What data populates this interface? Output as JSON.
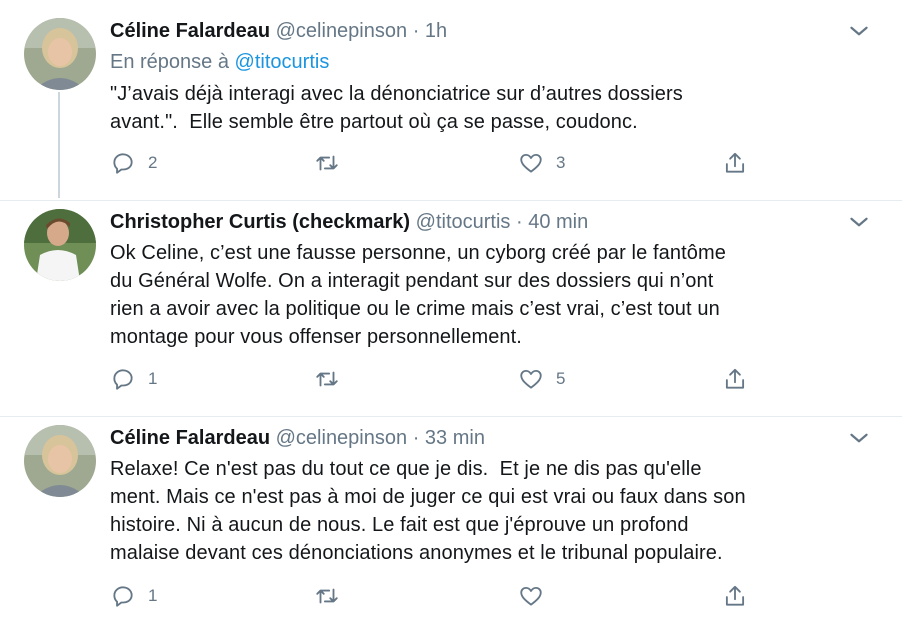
{
  "tweets": [
    {
      "name": "Céline Falardeau",
      "handle": "@celinepinson",
      "separator": "·",
      "time": "1h",
      "reply_prefix": "En réponse à",
      "reply_to": "@titocurtis",
      "text": "\"J’avais déjà interagi avec la dénonciatrice sur d’autres dossiers\navant.\".  Elle semble être partout où ça se passe, coudonc.",
      "replies": "2",
      "retweets": "",
      "likes": "3"
    },
    {
      "name": "Christopher Curtis (checkmark)",
      "handle": "@titocurtis",
      "separator": "·",
      "time": "40 min",
      "text": "Ok Celine, c’est une fausse personne, un cyborg créé par le fantôme\ndu Général Wolfe. On a interagit pendant sur des dossiers qui n’ont\nrien a avoir avec la politique ou le crime mais c’est vrai, c’est tout un\nmontage pour vous offenser personnellement.",
      "replies": "1",
      "retweets": "",
      "likes": "5"
    },
    {
      "name": "Céline Falardeau",
      "handle": "@celinepinson",
      "separator": "·",
      "time": "33 min",
      "text": "Relaxe! Ce n'est pas du tout ce que je dis.  Et je ne dis pas qu'elle\nment. Mais ce n'est pas à moi de juger ce qui est vrai ou faux dans son\nhistoire. Ni à aucun de nous. Le fait est que j'éprouve un profond\nmalaise devant ces dénonciations anonymes et le tribunal populaire.",
      "replies": "1",
      "retweets": "",
      "likes": ""
    }
  ],
  "icons": {
    "reply": "reply-icon",
    "retweet": "retweet-icon",
    "like": "like-icon",
    "share": "share-icon",
    "caret": "chevron-down-icon"
  },
  "colors": {
    "text": "#14171a",
    "muted": "#657786",
    "link": "#1b95e0",
    "thread_line": "#ccd6dd",
    "divider": "#e6ecf0"
  }
}
